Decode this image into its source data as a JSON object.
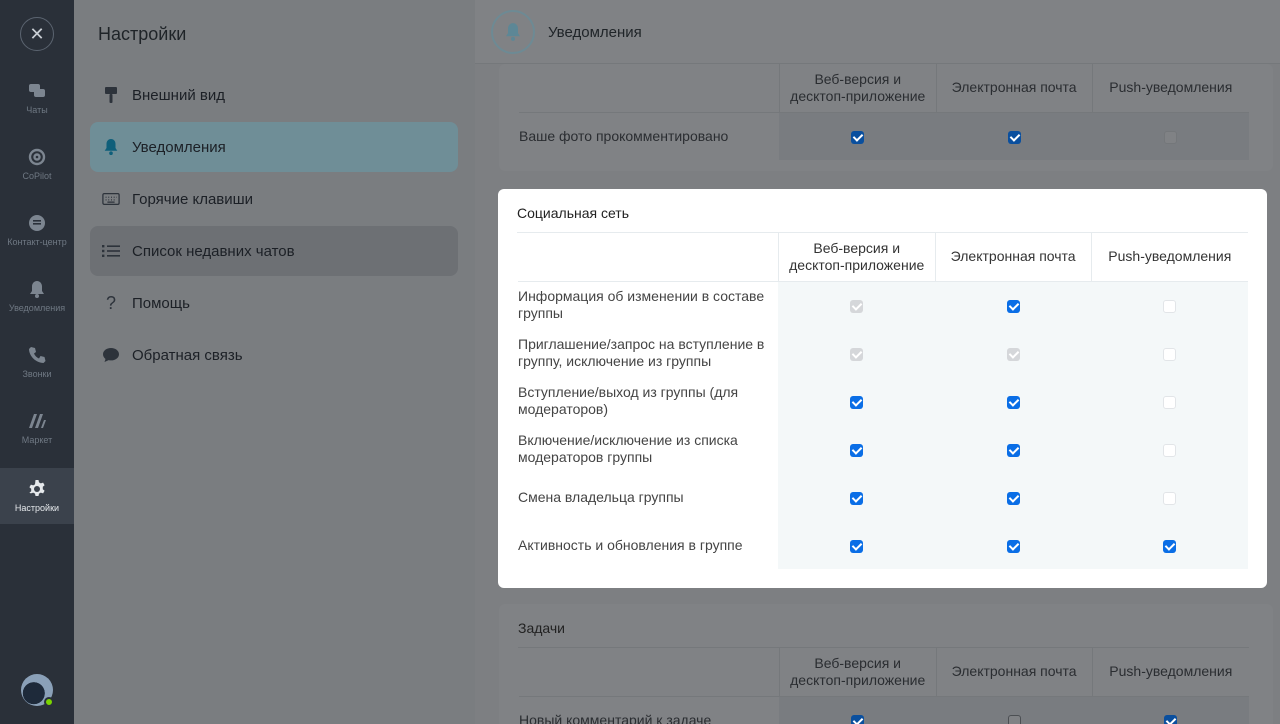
{
  "rail": {
    "close_symbol": "✕",
    "items": [
      {
        "label": "Чаты",
        "icon": "chats-icon"
      },
      {
        "label": "CoPilot",
        "icon": "copilot-icon"
      },
      {
        "label": "Контакт-центр",
        "icon": "contact-center-icon"
      },
      {
        "label": "Уведомления",
        "icon": "bell-icon"
      },
      {
        "label": "Звонки",
        "icon": "phone-icon"
      },
      {
        "label": "Маркет",
        "icon": "market-icon"
      },
      {
        "label": "Настройки",
        "icon": "gear-icon"
      }
    ]
  },
  "sidebar": {
    "title": "Настройки",
    "items": [
      {
        "label": "Внешний вид",
        "icon": "brush-icon"
      },
      {
        "label": "Уведомления",
        "icon": "bell-icon"
      },
      {
        "label": "Горячие клавиши",
        "icon": "keyboard-icon"
      },
      {
        "label": "Список недавних чатов",
        "icon": "list-icon"
      },
      {
        "label": "Помощь",
        "icon": "question-icon",
        "symbol": "?"
      },
      {
        "label": "Обратная связь",
        "icon": "chat-bubble-icon"
      }
    ]
  },
  "header": {
    "title": "Уведомления"
  },
  "columns": [
    "Веб-версия и десктоп-приложение",
    "Электронная почта",
    "Push-уведомления"
  ],
  "col_labels": {
    "web_line1": "Веб-версия и",
    "web_line2": "десктоп-приложение",
    "email": "Электронная почта",
    "push": "Push-уведомления"
  },
  "top_section": {
    "rows": [
      {
        "label": "Ваше фото прокомментировано",
        "web": "on",
        "email": "on",
        "push": "off"
      }
    ]
  },
  "social_section": {
    "title": "Социальная сеть",
    "rows": [
      {
        "label_1": "Информация об изменении в составе",
        "label_2": "группы",
        "web": "disabled-on",
        "email": "on",
        "push": "disabled-off"
      },
      {
        "label_1": "Приглашение/запрос на вступление в",
        "label_2": "группу, исключение из группы",
        "web": "disabled-on",
        "email": "disabled-on",
        "push": "disabled-off"
      },
      {
        "label_1": "Вступление/выход из группы (для",
        "label_2": "модераторов)",
        "web": "on",
        "email": "on",
        "push": "disabled-off"
      },
      {
        "label_1": "Включение/исключение из списка",
        "label_2": "модераторов группы",
        "web": "on",
        "email": "on",
        "push": "disabled-off"
      },
      {
        "label_1": "Смена владельца группы",
        "label_2": "",
        "web": "on",
        "email": "on",
        "push": "disabled-off"
      },
      {
        "label_1": "Активность и обновления в группе",
        "label_2": "",
        "web": "on",
        "email": "on",
        "push": "on"
      }
    ]
  },
  "tasks_section": {
    "title": "Задачи",
    "rows": [
      {
        "label": "Новый комментарий к задаче",
        "web": "on",
        "email": "off",
        "push": "on"
      }
    ]
  }
}
